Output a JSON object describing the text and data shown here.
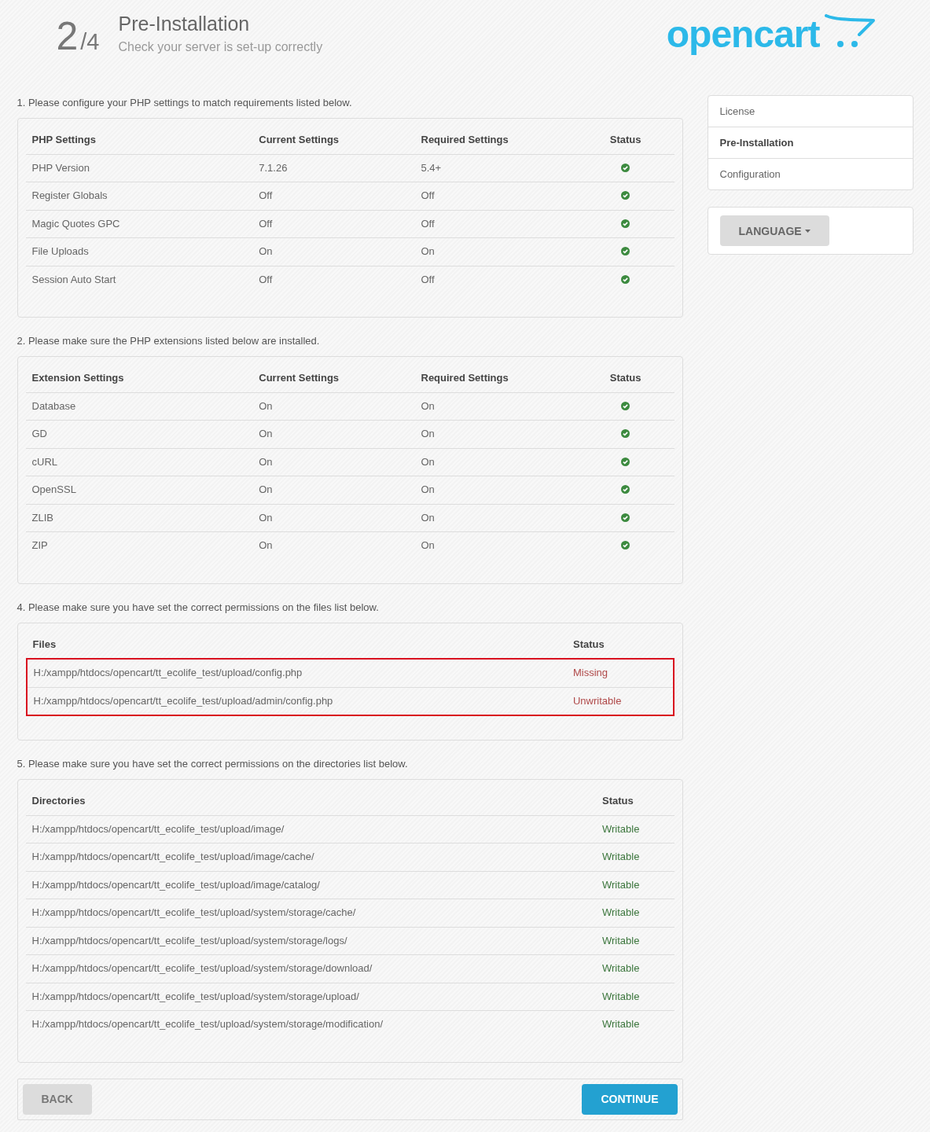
{
  "header": {
    "step": "2",
    "total": "/4",
    "title": "Pre-Installation",
    "subtitle": "Check your server is set-up correctly",
    "logo": "opencart"
  },
  "sections": [
    {
      "kind": "settings",
      "intro": "1. Please configure your PHP settings to match requirements listed below.",
      "columns": [
        "PHP Settings",
        "Current Settings",
        "Required Settings",
        "Status"
      ],
      "rows": [
        {
          "name": "PHP Version",
          "current": "7.1.26",
          "required": "5.4+",
          "ok": true
        },
        {
          "name": "Register Globals",
          "current": "Off",
          "required": "Off",
          "ok": true
        },
        {
          "name": "Magic Quotes GPC",
          "current": "Off",
          "required": "Off",
          "ok": true
        },
        {
          "name": "File Uploads",
          "current": "On",
          "required": "On",
          "ok": true
        },
        {
          "name": "Session Auto Start",
          "current": "Off",
          "required": "Off",
          "ok": true
        }
      ]
    },
    {
      "kind": "settings",
      "intro": "2. Please make sure the PHP extensions listed below are installed.",
      "columns": [
        "Extension Settings",
        "Current Settings",
        "Required Settings",
        "Status"
      ],
      "rows": [
        {
          "name": "Database",
          "current": "On",
          "required": "On",
          "ok": true
        },
        {
          "name": "GD",
          "current": "On",
          "required": "On",
          "ok": true
        },
        {
          "name": "cURL",
          "current": "On",
          "required": "On",
          "ok": true
        },
        {
          "name": "OpenSSL",
          "current": "On",
          "required": "On",
          "ok": true
        },
        {
          "name": "ZLIB",
          "current": "On",
          "required": "On",
          "ok": true
        },
        {
          "name": "ZIP",
          "current": "On",
          "required": "On",
          "ok": true
        }
      ]
    },
    {
      "kind": "paths",
      "intro": "4. Please make sure you have set the correct permissions on the files list below.",
      "columns": [
        "Files",
        "Status"
      ],
      "rows": [
        {
          "path": "H:/xampp/htdocs/opencart/tt_ecolife_test/upload/config.php",
          "status": "Missing",
          "ok": false,
          "highlighted": true
        },
        {
          "path": "H:/xampp/htdocs/opencart/tt_ecolife_test/upload/admin/config.php",
          "status": "Unwritable",
          "ok": false,
          "highlighted": true
        }
      ]
    },
    {
      "kind": "paths",
      "intro": "5. Please make sure you have set the correct permissions on the directories list below.",
      "columns": [
        "Directories",
        "Status"
      ],
      "rows": [
        {
          "path": "H:/xampp/htdocs/opencart/tt_ecolife_test/upload/image/",
          "status": "Writable",
          "ok": true,
          "highlighted": false
        },
        {
          "path": "H:/xampp/htdocs/opencart/tt_ecolife_test/upload/image/cache/",
          "status": "Writable",
          "ok": true,
          "highlighted": false
        },
        {
          "path": "H:/xampp/htdocs/opencart/tt_ecolife_test/upload/image/catalog/",
          "status": "Writable",
          "ok": true,
          "highlighted": false
        },
        {
          "path": "H:/xampp/htdocs/opencart/tt_ecolife_test/upload/system/storage/cache/",
          "status": "Writable",
          "ok": true,
          "highlighted": false
        },
        {
          "path": "H:/xampp/htdocs/opencart/tt_ecolife_test/upload/system/storage/logs/",
          "status": "Writable",
          "ok": true,
          "highlighted": false
        },
        {
          "path": "H:/xampp/htdocs/opencart/tt_ecolife_test/upload/system/storage/download/",
          "status": "Writable",
          "ok": true,
          "highlighted": false
        },
        {
          "path": "H:/xampp/htdocs/opencart/tt_ecolife_test/upload/system/storage/upload/",
          "status": "Writable",
          "ok": true,
          "highlighted": false
        },
        {
          "path": "H:/xampp/htdocs/opencart/tt_ecolife_test/upload/system/storage/modification/",
          "status": "Writable",
          "ok": true,
          "highlighted": false
        }
      ]
    }
  ],
  "actions": {
    "back": "BACK",
    "continue": "CONTINUE"
  },
  "sidebar": {
    "steps": [
      {
        "label": "License",
        "selected": false
      },
      {
        "label": "Pre-Installation",
        "selected": true
      },
      {
        "label": "Configuration",
        "selected": false
      }
    ],
    "language_button": "LANGUAGE"
  }
}
